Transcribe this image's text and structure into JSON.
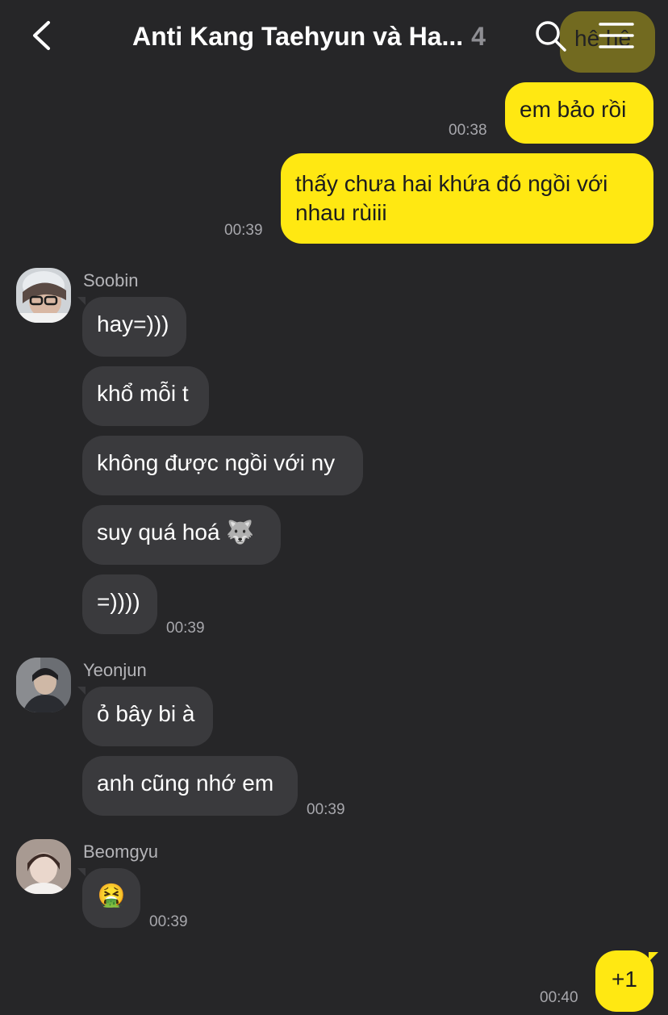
{
  "header": {
    "title": "Anti Kang Taehyun và Ha...",
    "member_count": "4"
  },
  "messages": {
    "m0": {
      "text": "hê hê"
    },
    "m1": {
      "text": "em bảo rồi",
      "time": "00:38"
    },
    "m2": {
      "text": "thấy chưa hai khứa đó ngồi với nhau rùiii",
      "time": "00:39"
    },
    "soobin": {
      "name": "Soobin",
      "lines": [
        "hay=)))",
        "khổ mỗi t",
        "không được ngồi với ny",
        "suy quá hoá 🐺",
        "=))))"
      ],
      "time": "00:39"
    },
    "yeonjun": {
      "name": "Yeonjun",
      "lines": [
        "ỏ bây bi à",
        "anh cũng nhớ em"
      ],
      "time": "00:39"
    },
    "beomgyu": {
      "name": "Beomgyu",
      "lines": [
        "🤮"
      ],
      "time": "00:39"
    },
    "m_last": {
      "text": "+1",
      "time": "00:40"
    }
  },
  "icons": {
    "back": "chevron-left-icon",
    "search": "search-icon",
    "menu": "hamburger-menu-icon"
  },
  "colors": {
    "background": "#262628",
    "my_bubble": "#ffe812",
    "their_bubble": "#3a3a3d"
  }
}
